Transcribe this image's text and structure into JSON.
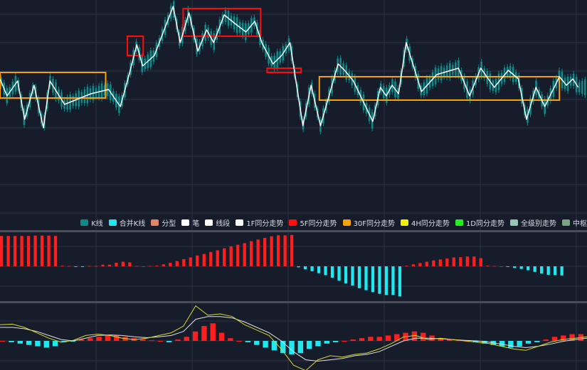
{
  "colors": {
    "background": "#171c2b",
    "grid": "#2c3245",
    "divider": "#4a4e58",
    "candle": "#0d8a8a",
    "bi_line": "#ffffff",
    "zhongshu_5f": "#ff0b0b",
    "zhongshu_30f": "#f5a10a",
    "macd_up": "#ff1e1e",
    "macd_down": "#1ee8f0",
    "dif": "#e0e0e0",
    "dea": "#d8d82a"
  },
  "legend": [
    {
      "label": "K线",
      "color": "#0d8a8a"
    },
    {
      "label": "合并K线",
      "color": "#1ee8f0"
    },
    {
      "label": "分型",
      "color": "#e0866a"
    },
    {
      "label": "笔",
      "color": "#ffffff"
    },
    {
      "label": "线段",
      "color": "#ffffff"
    },
    {
      "label": "1F同分走势",
      "color": "#ffffff"
    },
    {
      "label": "5F同分走势",
      "color": "#ff1010"
    },
    {
      "label": "30F同分走势",
      "color": "#f5a10a"
    },
    {
      "label": "4H同分走势",
      "color": "#f2f200"
    },
    {
      "label": "1D同分走势",
      "color": "#22ee22"
    },
    {
      "label": "全级别走势",
      "color": "#92c8b0"
    },
    {
      "label": "中枢",
      "color": "#7aa586"
    }
  ],
  "chart_data": {
    "type": "line",
    "x_range": [
      0,
      100
    ],
    "price_range": [
      0,
      100
    ],
    "bi": {
      "x": [
        0,
        1.2,
        3.0,
        4.2,
        5.8,
        7.4,
        8.5,
        11.0,
        15.5,
        18.5,
        20.5,
        22.0,
        23.3,
        24.3,
        26.3,
        29.5,
        30.7,
        32.2,
        33.7,
        35.2,
        36.4,
        38.2,
        40.0,
        41.9,
        43.4,
        44.6,
        46.5,
        48.0,
        49.4,
        51.6,
        53.0,
        54.6,
        57.6,
        58.7,
        60.2,
        63.5,
        64.8,
        65.8,
        66.8,
        67.9,
        69.2,
        71.8,
        74.4,
        78.1,
        80.0,
        81.9,
        84.2,
        86.6,
        88.3,
        89.7,
        91.3,
        92.8,
        95.3,
        96.5,
        97.6,
        98.5
      ],
      "y": [
        63,
        55,
        62,
        44,
        60,
        40,
        62,
        51,
        56,
        58,
        50,
        65,
        79,
        69,
        74,
        97,
        80,
        94,
        76,
        86,
        80,
        93,
        89,
        85,
        90,
        80,
        70,
        74,
        80,
        41,
        60,
        41,
        70,
        67,
        62,
        43,
        59,
        55,
        60,
        56,
        80,
        57,
        65,
        68,
        55,
        68,
        59,
        67,
        63,
        44,
        59,
        50,
        64,
        60,
        63,
        59
      ]
    },
    "zhongshu_30f": [
      {
        "x": [
          0,
          18
        ],
        "y": [
          54,
          66
        ]
      },
      {
        "x": [
          54.4,
          95.3
        ],
        "y": [
          53,
          64
        ]
      }
    ],
    "zhongshu_5f": [
      {
        "x": [
          21.7,
          24.4
        ],
        "y": [
          74,
          83
        ]
      },
      {
        "x": [
          31.2,
          44.4
        ],
        "y": [
          83,
          96
        ]
      },
      {
        "x": [
          45.5,
          51.3
        ],
        "y": [
          66,
          68
        ]
      }
    ],
    "macd_hist": {
      "range": [
        -1,
        1
      ],
      "values": [
        0.93,
        0.93,
        0.93,
        0.93,
        0.93,
        0.94,
        0.94,
        0.94,
        0.93,
        0.02,
        0.01,
        -0.02,
        -0.02,
        0.01,
        0.01,
        0.05,
        0.05,
        0.11,
        0.14,
        0.12,
        0.01,
        0.0,
        0.01,
        0.02,
        0.06,
        0.11,
        0.16,
        0.22,
        0.27,
        0.33,
        0.38,
        0.44,
        0.49,
        0.55,
        0.61,
        0.66,
        0.71,
        0.77,
        0.82,
        0.87,
        0.92,
        0.95,
        0.95,
        0.96,
        -0.03,
        -0.09,
        -0.15,
        -0.21,
        -0.27,
        -0.35,
        -0.44,
        -0.52,
        -0.59,
        -0.67,
        -0.73,
        -0.79,
        -0.84,
        -0.88,
        -0.88,
        -0.92,
        0.02,
        0.06,
        0.1,
        0.14,
        0.18,
        0.21,
        0.24,
        0.27,
        0.28,
        0.3,
        0.3,
        0.25,
        0.02,
        0.01,
        0.0,
        -0.02,
        -0.05,
        -0.08,
        -0.12,
        -0.17,
        -0.22,
        -0.26,
        -0.27,
        -0.28
      ]
    },
    "macd_lines": {
      "range": [
        -1,
        1
      ],
      "hist": [
        0.0,
        -0.05,
        -0.1,
        -0.15,
        -0.2,
        -0.25,
        -0.2,
        -0.05,
        -0.02,
        0.05,
        0.1,
        0.15,
        0.2,
        0.2,
        0.15,
        0.1,
        0.06,
        0.02,
        0.0,
        -0.05,
        0.05,
        0.15,
        0.35,
        0.55,
        0.65,
        0.3,
        0.1,
        0.0,
        -0.05,
        -0.15,
        -0.25,
        -0.35,
        -0.45,
        -0.5,
        -0.45,
        -0.3,
        -0.2,
        -0.1,
        -0.05,
        0.0,
        0.05,
        0.1,
        0.15,
        0.15,
        0.2,
        0.25,
        0.3,
        0.35,
        0.3,
        0.2,
        0.1,
        0.05,
        0.02,
        0.0,
        -0.05,
        -0.1,
        -0.15,
        -0.2,
        -0.25,
        -0.2,
        -0.1,
        -0.05,
        0.05,
        0.15,
        0.2,
        0.25,
        0.25
      ],
      "dif": [
        0.6,
        0.62,
        0.5,
        0.3,
        0.1,
        -0.05,
        0.02,
        0.2,
        0.25,
        0.2,
        0.1,
        0.05,
        0.1,
        0.2,
        0.3,
        0.55,
        1.3,
        0.95,
        1.0,
        0.9,
        0.6,
        0.4,
        0.2,
        -0.3,
        -0.9,
        -1.1,
        -0.7,
        -0.55,
        -0.6,
        -0.5,
        -0.45,
        -0.3,
        -0.1,
        0.15,
        0.2,
        0.05,
        0.1,
        0.05,
        0.0,
        -0.05,
        -0.1,
        -0.2,
        -0.3,
        -0.35,
        -0.2,
        -0.05,
        0.05,
        0.1,
        0.15
      ],
      "dea": [
        0.5,
        0.5,
        0.45,
        0.35,
        0.2,
        0.05,
        0.0,
        0.1,
        0.2,
        0.22,
        0.2,
        0.15,
        0.12,
        0.15,
        0.2,
        0.35,
        0.8,
        0.9,
        0.9,
        0.85,
        0.7,
        0.5,
        0.3,
        0.0,
        -0.4,
        -0.7,
        -0.75,
        -0.7,
        -0.65,
        -0.55,
        -0.5,
        -0.4,
        -0.2,
        0.0,
        0.1,
        0.1,
        0.08,
        0.05,
        0.02,
        0.0,
        -0.05,
        -0.12,
        -0.2,
        -0.25,
        -0.2,
        -0.12,
        -0.02,
        0.05,
        0.1
      ]
    }
  }
}
